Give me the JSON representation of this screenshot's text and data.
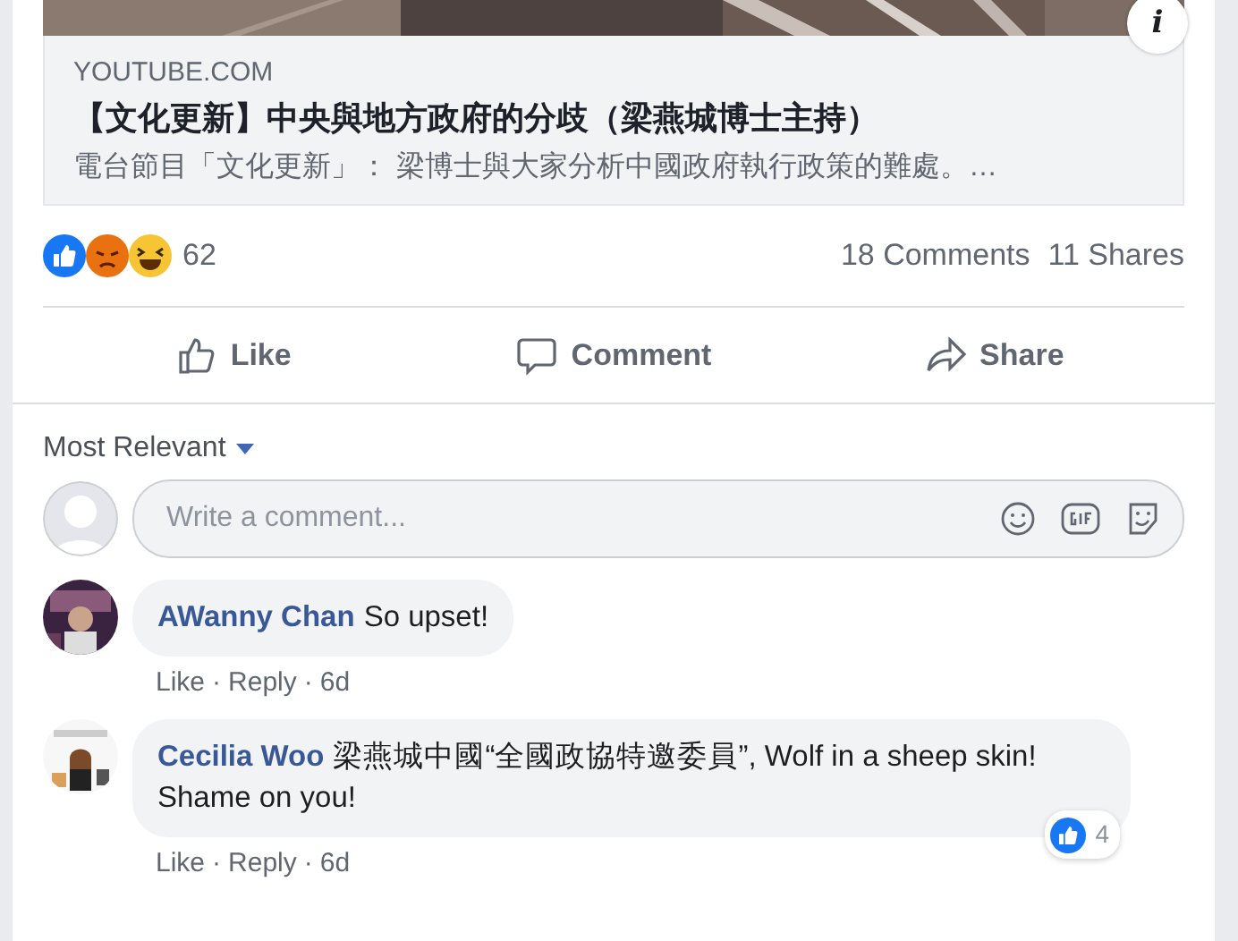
{
  "link_preview": {
    "kind": "picture",
    "domain": "YOUTUBE.COM",
    "title": "【文化更新】中央與地方政府的分歧（梁燕城博士主持）",
    "description": "電台節目「文化更新」： 梁博士與大家分析中國政府執行政策的難處。…",
    "info": "i"
  },
  "reactions": {
    "count": "62",
    "comments": "18 Comments",
    "shares": "11 Shares"
  },
  "actions": [
    {
      "kind": "like",
      "label": "Like"
    },
    {
      "kind": "comment",
      "label": "Comment"
    },
    {
      "kind": "share",
      "label": "Share"
    }
  ],
  "sort": {
    "label": "Most Relevant"
  },
  "composer": {
    "placeholder": "Write a comment..."
  },
  "comments": [
    {
      "author": "AWanny Chan",
      "text": "So upset!",
      "actions": [
        "Like",
        "Reply"
      ],
      "separator": "·",
      "time": "6d",
      "avatar": {
        "kind": "picture"
      }
    },
    {
      "author": "Cecilia Woo",
      "text": "梁燕城中國“全國政協特邀委員”, Wolf in a sheep skin! Shame on you!",
      "actions": [
        "Like",
        "Reply"
      ],
      "separator": "·",
      "time": "6d",
      "avatar": {
        "kind": "picture"
      },
      "likes": "4"
    }
  ]
}
